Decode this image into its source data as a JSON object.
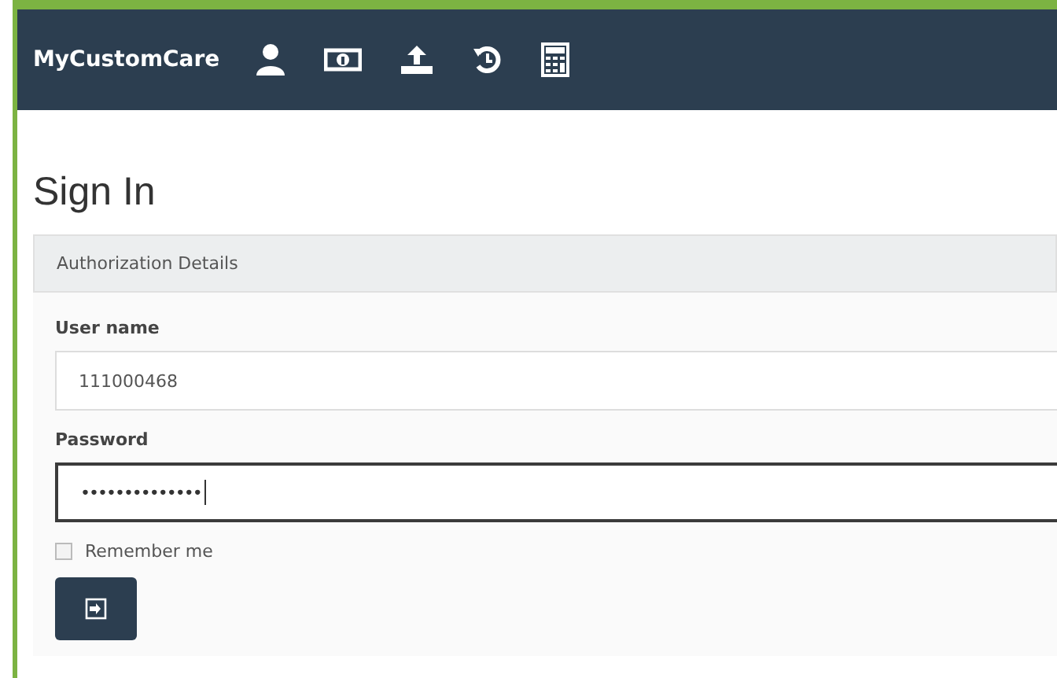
{
  "navbar": {
    "brand": "MyCustomCare"
  },
  "heading": "Sign In",
  "panel": {
    "title": "Authorization Details",
    "fields": [
      {
        "label": "User name",
        "value": "111000468",
        "focused": false
      },
      {
        "label": "Password",
        "value": "••••••••••••••",
        "focused": true
      }
    ],
    "remember": {
      "label": "Remember me",
      "checked": false
    }
  }
}
